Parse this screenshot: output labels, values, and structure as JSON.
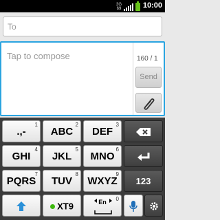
{
  "status_bar": {
    "network": "3G",
    "network_sub": "69",
    "battery_icon": "battery-icon",
    "time": "10:00"
  },
  "composer": {
    "to_placeholder": "To",
    "compose_placeholder": "Tap to compose",
    "char_counter": "160 / 1",
    "send_label": "Send",
    "attach_icon": "paperclip-icon"
  },
  "keyboard": {
    "keys": {
      "k1": {
        "label": ".,-",
        "num": "1"
      },
      "k2": {
        "label": "ABC",
        "num": "2"
      },
      "k3": {
        "label": "DEF",
        "num": "3"
      },
      "k4": {
        "label": "GHI",
        "num": "4"
      },
      "k5": {
        "label": "JKL",
        "num": "5"
      },
      "k6": {
        "label": "MNO",
        "num": "6"
      },
      "k7": {
        "label": "PQRS",
        "num": "7"
      },
      "k8": {
        "label": "TUV",
        "num": "8"
      },
      "k9": {
        "label": "WXYZ",
        "num": "9"
      },
      "k0": {
        "label": "En",
        "num": "0"
      },
      "mode": "123",
      "xt9": "XT9"
    }
  },
  "colors": {
    "accent": "#2aa4e0",
    "battery": "#67c21a",
    "xt9_dot": "#3db80e"
  }
}
